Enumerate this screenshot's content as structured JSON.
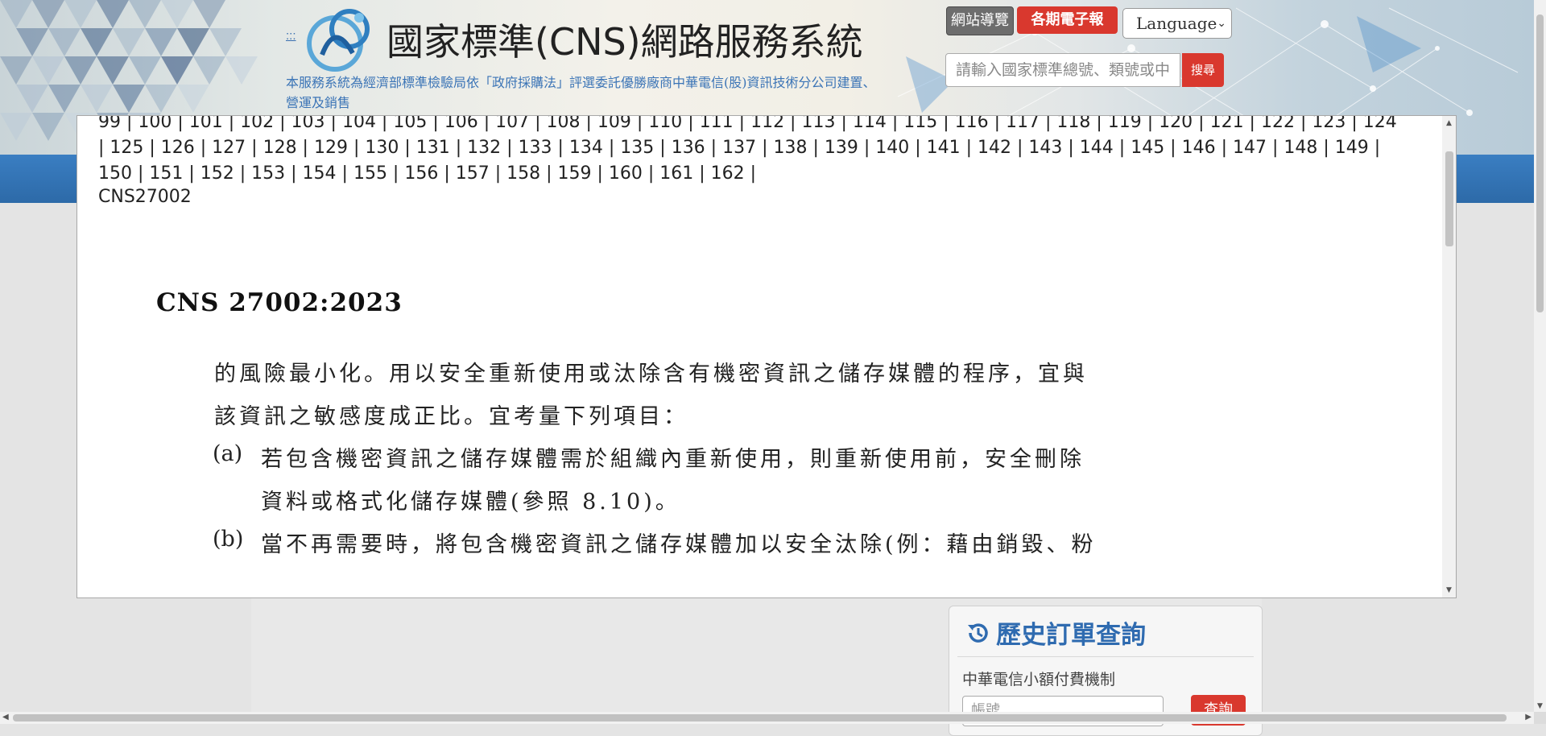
{
  "header": {
    "skip_link": ":::",
    "site_title": "國家標準(CNS)網路服務系統",
    "subtitle": "本服務系統為經濟部標準檢驗局依「政府採購法」評選委託優勝廠商中華電信(股)資訊技術分公司建置、營運及銷售",
    "guide_label": "網站導覽",
    "epaper_label": "各期電子報",
    "language_label": "Language",
    "search_placeholder": "請輸入國家標準總號、類號或中",
    "search_button": "搜尋"
  },
  "viewer": {
    "page_lines": [
      "99 | 100 | 101 | 102 | 103 | 104 | 105 | 106 | 107 | 108 | 109 | 110 | 111 | 112 | 113 | 114 | 115 | 116 | 117 | 118 | 119 | 120 | 121 | 122 | 123 | 124",
      "| 125 | 126 | 127 | 128 | 129 | 130 | 131 | 132 | 133 | 134 | 135 | 136 | 137 | 138 | 139 | 140 | 141 | 142 | 143 | 144 | 145 | 146 | 147 | 148 | 149 |",
      "150 | 151 | 152 | 153 | 154 | 155 | 156 | 157 | 158 | 159 | 160 | 161 | 162 |"
    ],
    "doc_id": "CNS27002",
    "doc_heading": "CNS 27002:2023",
    "para_line1": "的風險最小化。用以安全重新使用或汰除含有機密資訊之儲存媒體的程序，宜與",
    "para_line2": "該資訊之敏感度成正比。宜考量下列項目：",
    "item_a_mark": "(a)",
    "item_a_line1": "若包含機密資訊之儲存媒體需於組織內重新使用，則重新使用前，安全刪除",
    "item_a_line2": "資料或格式化儲存媒體(參照 8.10)。",
    "item_b_mark": "(b)",
    "item_b_line1": "當不再需要時，將包含機密資訊之儲存媒體加以安全汰除(例：藉由銷毀、粉"
  },
  "side_panel": {
    "title": "歷史訂單查詢",
    "payment_label": "中華電信小額付費機制",
    "account_placeholder": "帳號",
    "query_button": "查詢"
  },
  "colors": {
    "accent_red": "#d9382e",
    "accent_blue": "#2f6bb0",
    "nav_blue": "#3a7ec2"
  }
}
